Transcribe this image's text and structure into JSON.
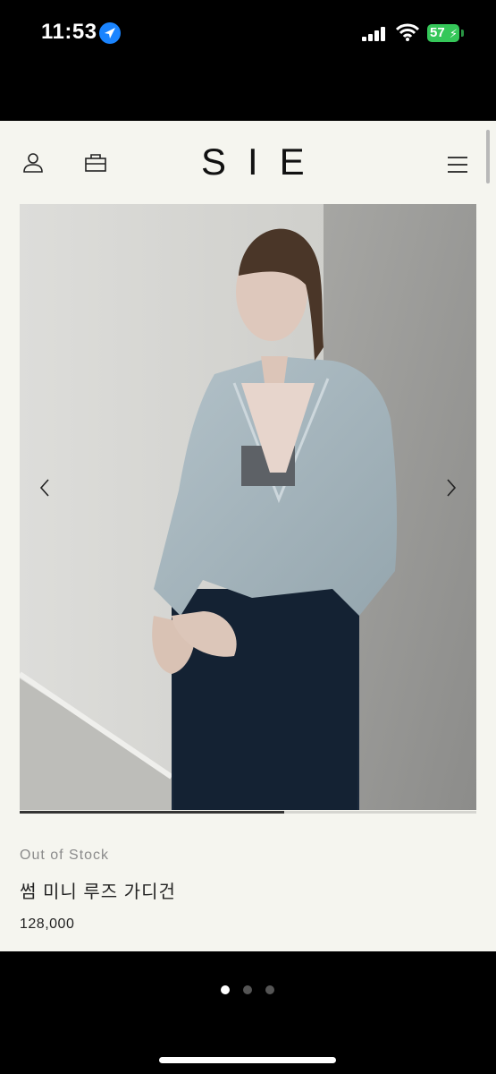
{
  "status_bar": {
    "time": "11:53",
    "battery_level": "57",
    "location_icon": "location-arrow-icon",
    "signal_icon": "cellular-signal-icon",
    "wifi_icon": "wifi-icon"
  },
  "viewer": {
    "close_icon": "close-icon"
  },
  "site": {
    "logo": "SIE",
    "account_icon": "account-icon",
    "bag_icon": "shopping-bag-icon",
    "menu_icon": "menu-icon"
  },
  "gallery": {
    "image_description": "Woman wearing a light blue loose cardigan and a navy skirt",
    "progress_fraction": 0.58,
    "prev_icon": "chevron-left-icon",
    "next_icon": "chevron-right-icon"
  },
  "product": {
    "stock_status": "Out of Stock",
    "name": "썸 미니 루즈 가디건",
    "price": "128,000"
  },
  "pager": {
    "count": 3,
    "active_index": 0
  },
  "colors": {
    "page_bg": "#f5f5ef",
    "screen_bg": "#000000",
    "location": "#1a84ff",
    "battery": "#35c759"
  }
}
